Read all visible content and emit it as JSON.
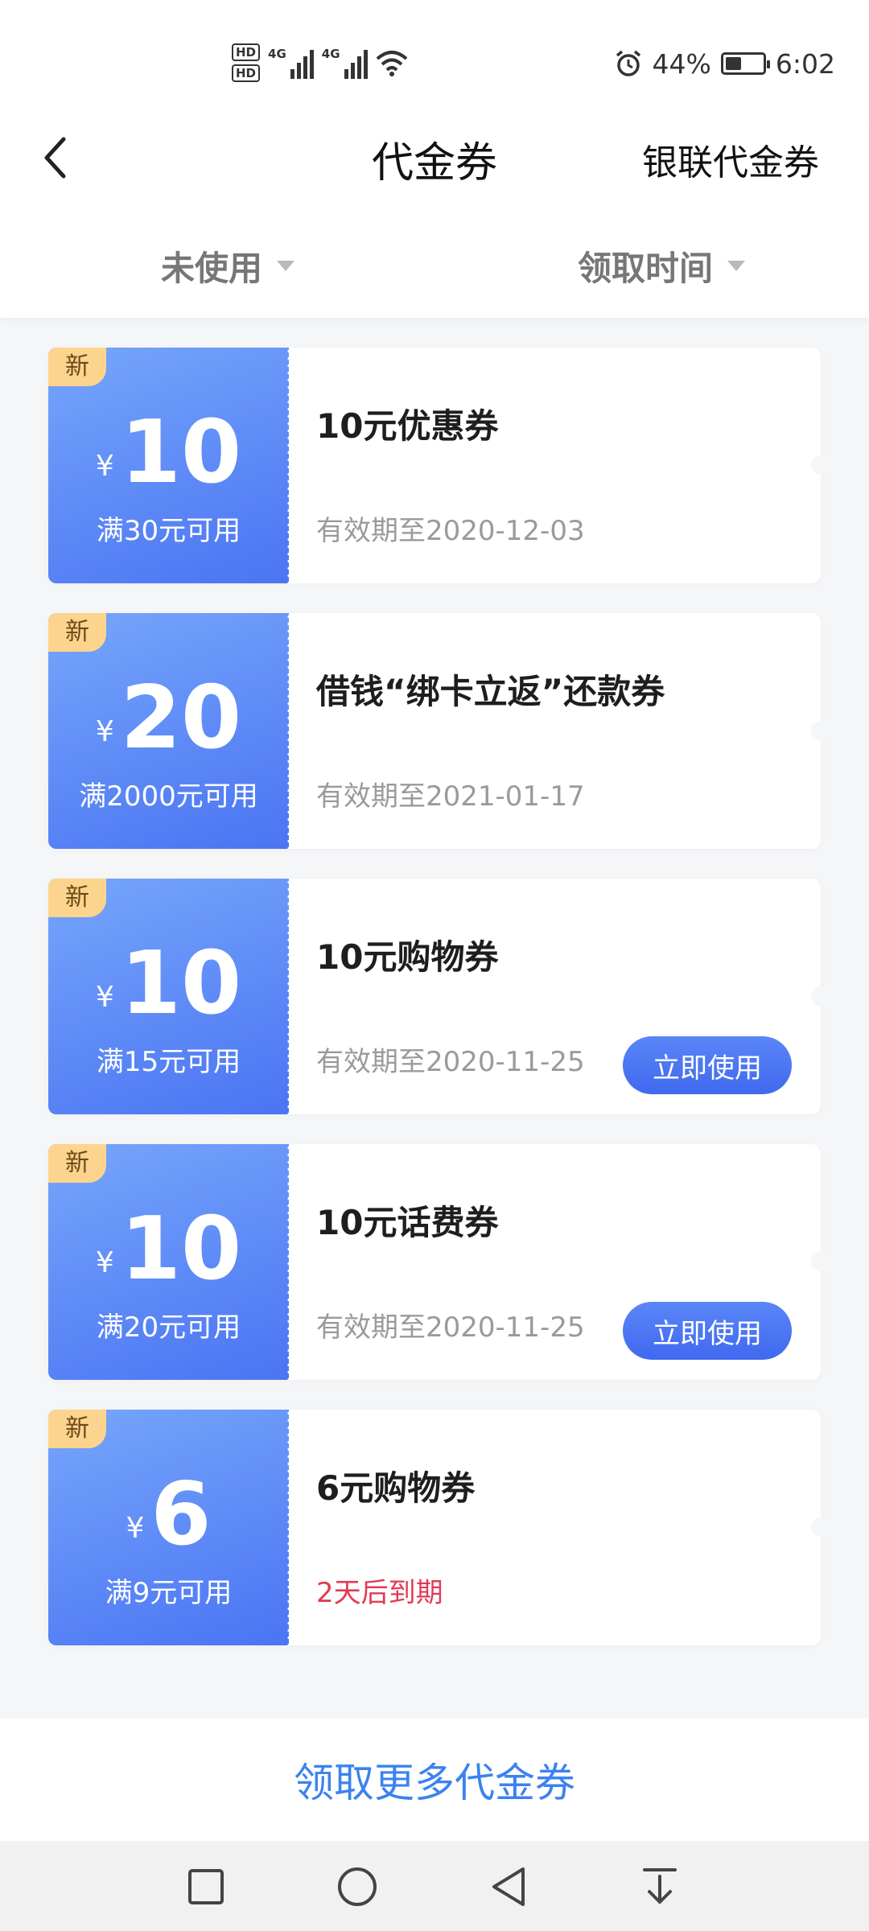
{
  "status_bar": {
    "hd1": "HD",
    "hd2": "HD",
    "net1": "4G",
    "net2": "4G",
    "battery_percent": "44%",
    "battery_level": 0.44,
    "time": "6:02"
  },
  "header": {
    "title": "代金券",
    "right_link": "银联代金券",
    "filter_status": "未使用",
    "filter_sort": "领取时间"
  },
  "coupons": [
    {
      "badge": "新",
      "currency": "¥",
      "amount": "10",
      "condition": "满30元可用",
      "name": "10元优惠券",
      "validity": "有效期至2020-12-03"
    },
    {
      "badge": "新",
      "currency": "¥",
      "amount": "20",
      "condition": "满2000元可用",
      "name": "借钱“绑卡立返”还款券",
      "validity": "有效期至2021-01-17"
    },
    {
      "badge": "新",
      "currency": "¥",
      "amount": "10",
      "condition": "满15元可用",
      "name": "10元购物券",
      "validity": "有效期至2020-11-25",
      "button": "立即使用"
    },
    {
      "badge": "新",
      "currency": "¥",
      "amount": "10",
      "condition": "满20元可用",
      "name": "10元话费券",
      "validity": "有效期至2020-11-25",
      "button": "立即使用"
    },
    {
      "badge": "新",
      "currency": "¥",
      "amount": "6",
      "condition": "满9元可用",
      "name": "6元购物券",
      "validity": "2天后到期"
    }
  ],
  "footer": {
    "more_label": "领取更多代金券"
  },
  "colors": {
    "accent": "#3b82f0",
    "coupon_gradient_start": "#76a6fb",
    "coupon_gradient_end": "#4b74f3",
    "badge": "#fdd48e",
    "expiry_warning": "#e23a54"
  },
  "icons": {
    "back": "chevron-left-icon",
    "alarm": "alarm-icon",
    "wifi": "wifi-icon",
    "nav_recent": "square-icon",
    "nav_home": "circle-icon",
    "nav_back": "triangle-back-icon",
    "nav_notifications": "pull-down-icon"
  }
}
